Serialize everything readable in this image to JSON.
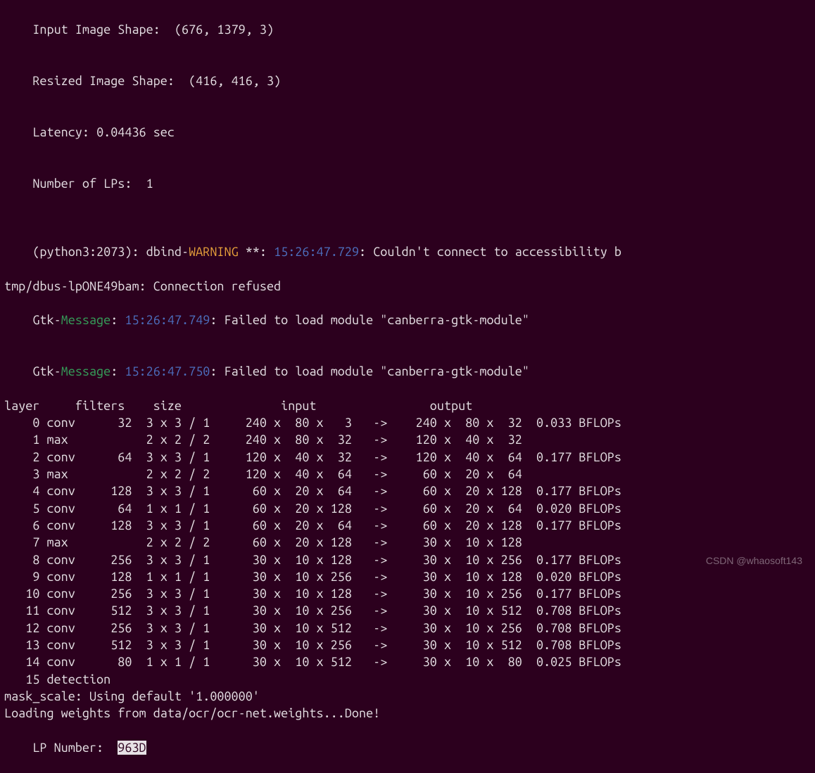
{
  "header": {
    "input_shape_label": "Input Image Shape:  ",
    "input_shape_value": "(676, 1379, 3)",
    "resized_shape_label": "Resized Image Shape:  ",
    "resized_shape_value": "(416, 416, 3)",
    "latency_label": "Latency: ",
    "latency_value": "0.04436 sec",
    "num_lp_label": "Number of LPs:  ",
    "num_lp_value": "1"
  },
  "dbind": {
    "prefix": "(python3:2073): dbind-",
    "warn_word": "WARNING",
    "stars": " **: ",
    "ts": "15:26:47.729",
    "tail": ": Couldn't connect to accessibility b",
    "line2": "tmp/dbus-lpONE49bam: Connection refused"
  },
  "gtk1": {
    "pre": "Gtk-",
    "msg": "Message",
    "colon": ": ",
    "ts": "15:26:47.749",
    "tail": ": Failed to load module \"canberra-gtk-module\""
  },
  "gtk2": {
    "pre": "Gtk-",
    "msg": "Message",
    "colon": ": ",
    "ts": "15:26:47.750",
    "tail": ": Failed to load module \"canberra-gtk-module\""
  },
  "table_header": "layer     filters    size              input                output",
  "layers": [
    {
      "idx": 0,
      "type": "conv",
      "filters": 32,
      "size": "3 x 3 / 1",
      "in": "240 x  80 x   3",
      "out": "240 x  80 x  32",
      "bflops": "0.033 BFLOPs"
    },
    {
      "idx": 1,
      "type": "max",
      "filters": "",
      "size": "2 x 2 / 2",
      "in": "240 x  80 x  32",
      "out": "120 x  40 x  32",
      "bflops": ""
    },
    {
      "idx": 2,
      "type": "conv",
      "filters": 64,
      "size": "3 x 3 / 1",
      "in": "120 x  40 x  32",
      "out": "120 x  40 x  64",
      "bflops": "0.177 BFLOPs"
    },
    {
      "idx": 3,
      "type": "max",
      "filters": "",
      "size": "2 x 2 / 2",
      "in": "120 x  40 x  64",
      "out": " 60 x  20 x  64",
      "bflops": ""
    },
    {
      "idx": 4,
      "type": "conv",
      "filters": 128,
      "size": "3 x 3 / 1",
      "in": " 60 x  20 x  64",
      "out": " 60 x  20 x 128",
      "bflops": "0.177 BFLOPs"
    },
    {
      "idx": 5,
      "type": "conv",
      "filters": 64,
      "size": "1 x 1 / 1",
      "in": " 60 x  20 x 128",
      "out": " 60 x  20 x  64",
      "bflops": "0.020 BFLOPs"
    },
    {
      "idx": 6,
      "type": "conv",
      "filters": 128,
      "size": "3 x 3 / 1",
      "in": " 60 x  20 x  64",
      "out": " 60 x  20 x 128",
      "bflops": "0.177 BFLOPs"
    },
    {
      "idx": 7,
      "type": "max",
      "filters": "",
      "size": "2 x 2 / 2",
      "in": " 60 x  20 x 128",
      "out": " 30 x  10 x 128",
      "bflops": ""
    },
    {
      "idx": 8,
      "type": "conv",
      "filters": 256,
      "size": "3 x 3 / 1",
      "in": " 30 x  10 x 128",
      "out": " 30 x  10 x 256",
      "bflops": "0.177 BFLOPs"
    },
    {
      "idx": 9,
      "type": "conv",
      "filters": 128,
      "size": "1 x 1 / 1",
      "in": " 30 x  10 x 256",
      "out": " 30 x  10 x 128",
      "bflops": "0.020 BFLOPs"
    },
    {
      "idx": 10,
      "type": "conv",
      "filters": 256,
      "size": "3 x 3 / 1",
      "in": " 30 x  10 x 128",
      "out": " 30 x  10 x 256",
      "bflops": "0.177 BFLOPs"
    },
    {
      "idx": 11,
      "type": "conv",
      "filters": 512,
      "size": "3 x 3 / 1",
      "in": " 30 x  10 x 256",
      "out": " 30 x  10 x 512",
      "bflops": "0.708 BFLOPs"
    },
    {
      "idx": 12,
      "type": "conv",
      "filters": 256,
      "size": "3 x 3 / 1",
      "in": " 30 x  10 x 512",
      "out": " 30 x  10 x 256",
      "bflops": "0.708 BFLOPs"
    },
    {
      "idx": 13,
      "type": "conv",
      "filters": 512,
      "size": "3 x 3 / 1",
      "in": " 30 x  10 x 256",
      "out": " 30 x  10 x 512",
      "bflops": "0.708 BFLOPs"
    },
    {
      "idx": 14,
      "type": "conv",
      "filters": 80,
      "size": "1 x 1 / 1",
      "in": " 30 x  10 x 512",
      "out": " 30 x  10 x  80",
      "bflops": "0.025 BFLOPs"
    },
    {
      "idx": 15,
      "type": "detection",
      "filters": "",
      "size": "",
      "in": "",
      "out": "",
      "bflops": ""
    }
  ],
  "footer": {
    "mask_scale": "mask_scale: Using default '1.000000'",
    "loading": "Loading weights from data/ocr/ocr-net.weights...Done!",
    "lp_label": "LP Number:  ",
    "lp_value": "963D"
  },
  "watermark": "CSDN @whaosoft143"
}
